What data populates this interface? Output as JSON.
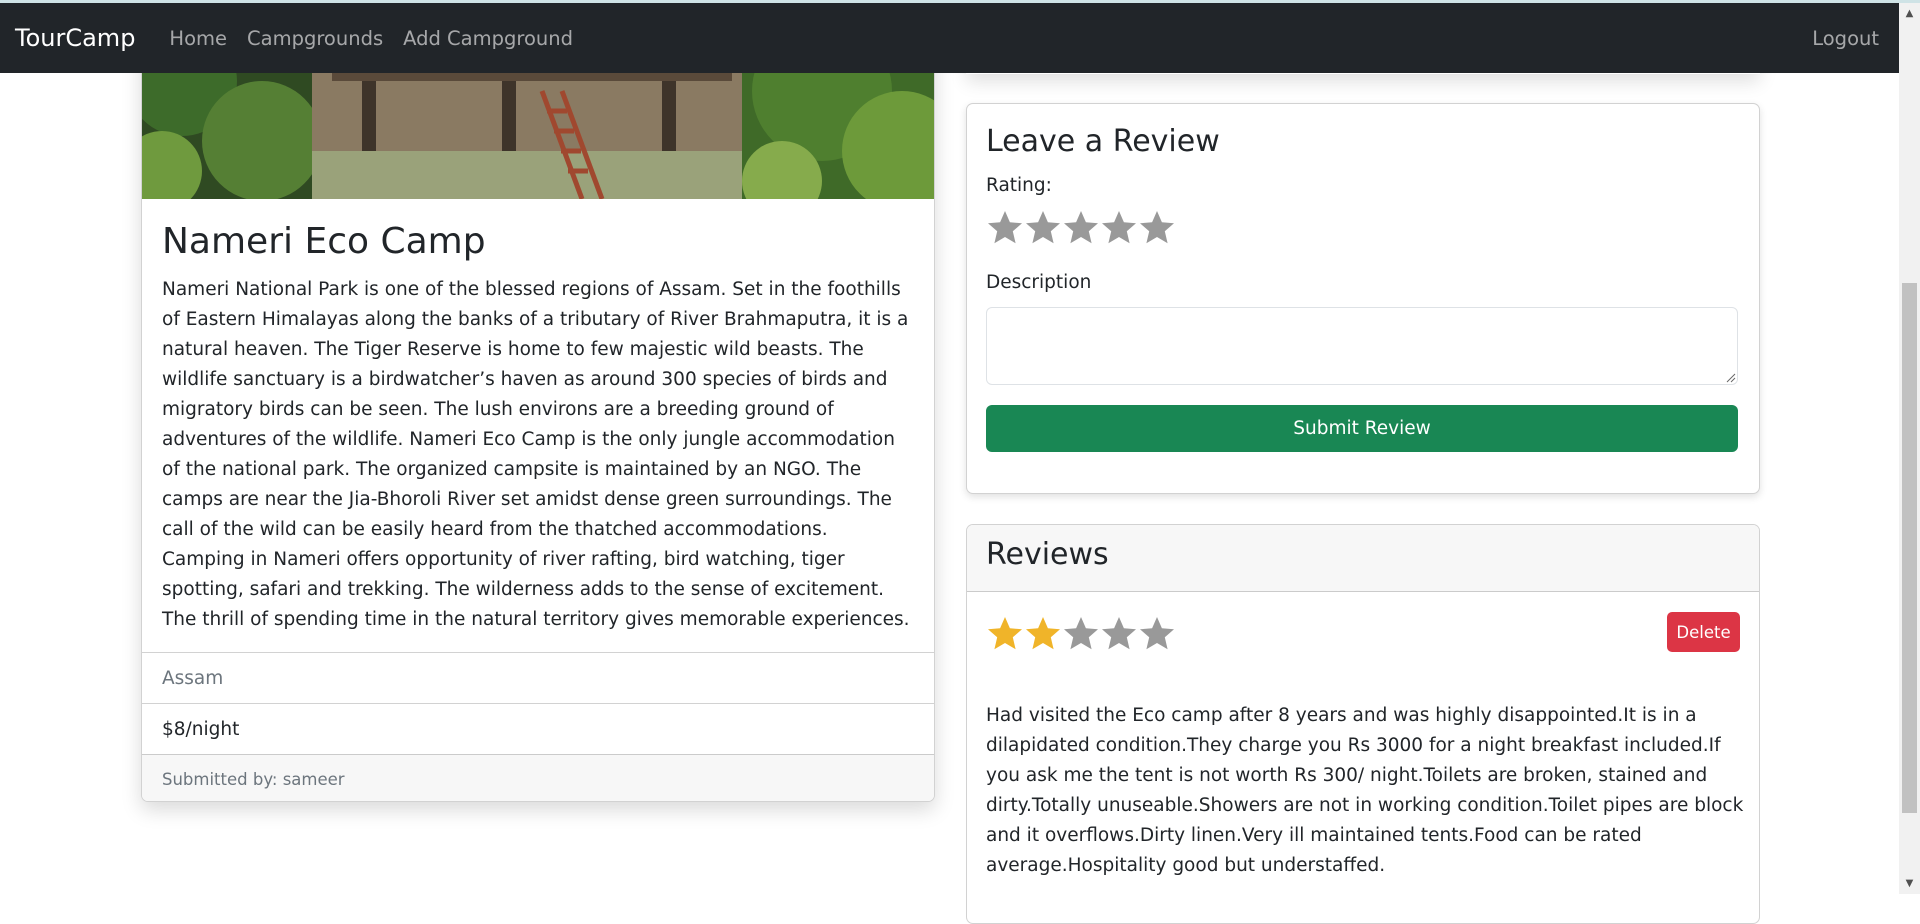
{
  "navbar": {
    "brand": "TourCamp",
    "links": [
      "Home",
      "Campgrounds",
      "Add Campground"
    ],
    "logout": "Logout"
  },
  "campground": {
    "title": "Nameri Eco Camp",
    "description": "Nameri National Park is one of the blessed regions of Assam. Set in the foothills of Eastern Himalayas along the banks of a tributary of River Brahmaputra, it is a natural heaven. The Tiger Reserve is home to few majestic wild beasts. The wildlife sanctuary is a birdwatcher’s haven as around 300 species of birds and migratory birds can be seen. The lush environs are a breeding ground of adventures of the wildlife. Nameri Eco Camp is the only jungle accommodation of the national park. The organized campsite is maintained by an NGO. The camps are near the Jia-Bhoroli River set amidst dense green surroundings. The call of the wild can be easily heard from the thatched accommodations. Camping in Nameri offers opportunity of river rafting, bird watching, tiger spotting, safari and trekking. The wilderness adds to the sense of excitement. The thrill of spending time in the natural territory gives memorable experiences.",
    "location": "Assam",
    "price": "$8/night",
    "submitted_by": "Submitted by: sameer"
  },
  "review_form": {
    "title": "Leave a Review",
    "rating_label": "Rating:",
    "rating_value": 0,
    "rating_max": 5,
    "description_label": "Description",
    "description_value": "",
    "submit_label": "Submit Review"
  },
  "reviews": {
    "title": "Reviews",
    "items": [
      {
        "rating": 2,
        "rating_max": 5,
        "delete_label": "Delete",
        "body": "Had visited the Eco camp after 8 years and was highly disappointed.It is in a dilapidated condition.They charge you Rs 3000 for a night breakfast included.If you ask me the tent is not worth Rs 300/ night.Toilets are broken, stained and dirty.Totally unuseable.Showers are not in working condition.Toilet pipes are block and it overflows.Dirty linen.Very ill maintained tents.Food can be rated average.Hospitality good but understaffed."
      }
    ]
  },
  "colors": {
    "navbar_bg": "#212529",
    "success": "#198754",
    "danger": "#dc3545",
    "star_filled": "#f0b429",
    "star_empty": "#999999"
  },
  "icons": {
    "star": "star-icon"
  }
}
